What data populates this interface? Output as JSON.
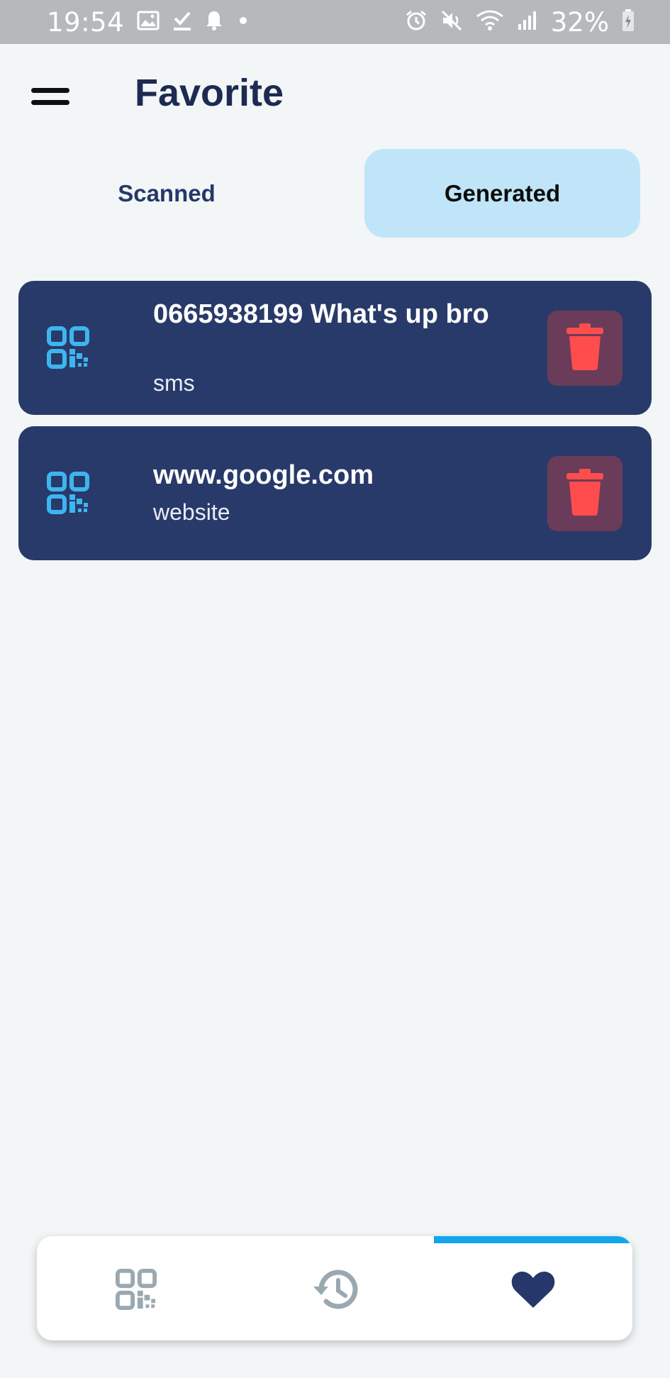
{
  "status_bar": {
    "time": "19:54",
    "battery": "32%",
    "left_icons": [
      "gallery-icon",
      "download-done-icon",
      "notification-bell-icon",
      "dot-icon"
    ],
    "right_icons": [
      "alarm-icon",
      "mute-icon",
      "wifi-icon",
      "signal-icon",
      "battery-charging-icon"
    ]
  },
  "header": {
    "title": "Favorite",
    "menu_icon": "hamburger-menu-icon"
  },
  "tabs": [
    {
      "label": "Scanned",
      "active": false
    },
    {
      "label": "Generated",
      "active": true
    }
  ],
  "items": [
    {
      "title": "0665938199 What's up bro",
      "type": "sms",
      "icon": "qr-code-icon",
      "action_icon": "trash-icon"
    },
    {
      "title": "www.google.com",
      "type": "website",
      "icon": "qr-code-icon",
      "action_icon": "trash-icon"
    }
  ],
  "bottom_nav": {
    "items": [
      {
        "name": "scan",
        "icon": "qr-code-icon",
        "active": false
      },
      {
        "name": "history",
        "icon": "history-icon",
        "active": false
      },
      {
        "name": "favorite",
        "icon": "heart-icon",
        "active": true
      }
    ]
  },
  "colors": {
    "background": "#f2f6f7",
    "card": "#283a69",
    "accent": "#13a6ec",
    "active_tab": "#c0e5f8",
    "delete": "#ff4d4d",
    "title": "#1d2a52"
  }
}
